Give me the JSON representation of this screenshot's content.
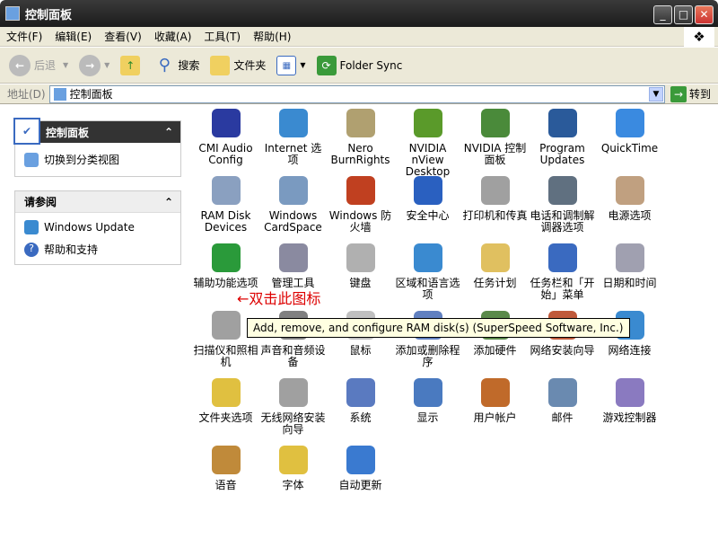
{
  "window": {
    "title": "控制面板"
  },
  "menu": [
    "文件(F)",
    "编辑(E)",
    "查看(V)",
    "收藏(A)",
    "工具(T)",
    "帮助(H)"
  ],
  "toolbar": {
    "back": "后退",
    "search": "搜索",
    "folders": "文件夹",
    "folder_sync": "Folder Sync"
  },
  "address": {
    "label": "地址(D)",
    "value": "控制面板",
    "go": "转到"
  },
  "sidebar": {
    "panel1": {
      "title": "控制面板",
      "items": [
        "切换到分类视图"
      ]
    },
    "panel2": {
      "title": "请参阅",
      "items": [
        "Windows Update",
        "帮助和支持"
      ]
    }
  },
  "icons": [
    {
      "label": "CMI Audio Config",
      "color": "#2a3aa0"
    },
    {
      "label": "Internet 选项",
      "color": "#3a8ad0"
    },
    {
      "label": "Nero BurnRights",
      "color": "#b0a070"
    },
    {
      "label": "NVIDIA nView Desktop M...",
      "color": "#5a9a2a"
    },
    {
      "label": "NVIDIA 控制面板",
      "color": "#4a8a3a"
    },
    {
      "label": "Program Updates",
      "color": "#2a5a9a"
    },
    {
      "label": "QuickTime",
      "color": "#3a8ae0"
    },
    {
      "label": "RAM Disk Devices",
      "color": "#8aa0c0"
    },
    {
      "label": "Windows CardSpace",
      "color": "#7a9ac0"
    },
    {
      "label": "Windows 防火墙",
      "color": "#c04020"
    },
    {
      "label": "安全中心",
      "color": "#2a60c0"
    },
    {
      "label": "打印机和传真",
      "color": "#a0a0a0"
    },
    {
      "label": "电话和调制解调器选项",
      "color": "#607080"
    },
    {
      "label": "电源选项",
      "color": "#c0a080"
    },
    {
      "label": "辅助功能选项",
      "color": "#2a9a3a"
    },
    {
      "label": "管理工具",
      "color": "#8a8aa0"
    },
    {
      "label": "键盘",
      "color": "#b0b0b0"
    },
    {
      "label": "区域和语言选项",
      "color": "#3a8ad0"
    },
    {
      "label": "任务计划",
      "color": "#e0c060"
    },
    {
      "label": "任务栏和「开始」菜单",
      "color": "#3a6ac0"
    },
    {
      "label": "日期和时间",
      "color": "#a0a0b0"
    },
    {
      "label": "扫描仪和照相机",
      "color": "#a0a0a0"
    },
    {
      "label": "声音和音频设备",
      "color": "#808080"
    },
    {
      "label": "鼠标",
      "color": "#c0c0c0"
    },
    {
      "label": "添加或删除程序",
      "color": "#6080c0"
    },
    {
      "label": "添加硬件",
      "color": "#5a8a4a"
    },
    {
      "label": "网络安装向导",
      "color": "#c05a3a"
    },
    {
      "label": "网络连接",
      "color": "#3a8ad0"
    },
    {
      "label": "文件夹选项",
      "color": "#e0c040"
    },
    {
      "label": "无线网络安装向导",
      "color": "#a0a0a0"
    },
    {
      "label": "系统",
      "color": "#5a7ac0"
    },
    {
      "label": "显示",
      "color": "#4a7ac0"
    },
    {
      "label": "用户帐户",
      "color": "#c06a2a"
    },
    {
      "label": "邮件",
      "color": "#6a8ab0"
    },
    {
      "label": "游戏控制器",
      "color": "#8a7ac0"
    },
    {
      "label": "语音",
      "color": "#c08a3a"
    },
    {
      "label": "字体",
      "color": "#e0c040"
    },
    {
      "label": "自动更新",
      "color": "#3a7ad0"
    }
  ],
  "annotation": "←双击此图标",
  "tooltip": "Add, remove, and configure RAM disk(s) (SuperSpeed Software, Inc.)"
}
